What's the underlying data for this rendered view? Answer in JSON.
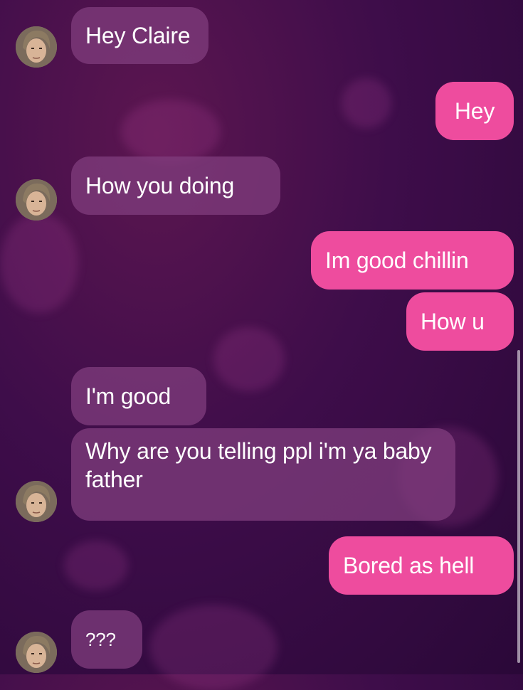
{
  "messages": [
    {
      "direction": "incoming",
      "text": "Hey Claire"
    },
    {
      "direction": "outgoing",
      "text": "Hey"
    },
    {
      "direction": "incoming",
      "text": "How you doing"
    },
    {
      "direction": "outgoing",
      "text": "Im good chillin"
    },
    {
      "direction": "outgoing",
      "text": "How u"
    },
    {
      "direction": "incoming",
      "text": "I'm good"
    },
    {
      "direction": "incoming",
      "text": "Why are you telling ppl i'm ya baby father"
    },
    {
      "direction": "outgoing",
      "text": "Bored as hell"
    },
    {
      "direction": "incoming",
      "text": "???"
    }
  ],
  "colors": {
    "background": "#3e0d4a",
    "incoming_bubble": "#803e7e",
    "outgoing_bubble": "#ee4c9e",
    "text": "#ffffff"
  },
  "icons": {
    "contact_avatar": "contact-avatar-icon",
    "background_pattern": "heart-icon"
  }
}
